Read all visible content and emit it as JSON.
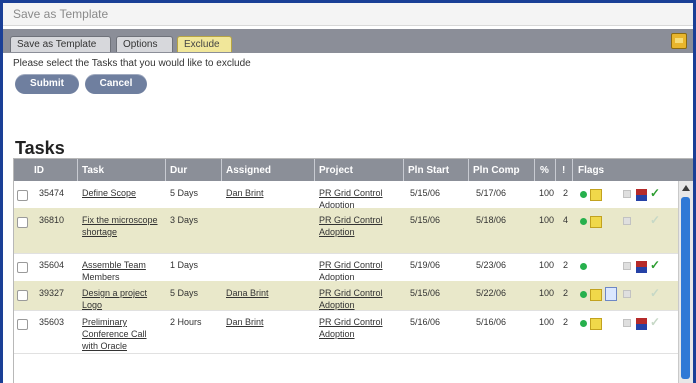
{
  "window": {
    "title": "Save as Template"
  },
  "tabs": [
    "Save as Template",
    "Options",
    "Exclude"
  ],
  "instructions": "Please select the Tasks that you would like to exclude",
  "buttons": {
    "submit": "Submit",
    "cancel": "Cancel"
  },
  "section_title": "Tasks",
  "table": {
    "columns": [
      "ID",
      "Task",
      "Dur",
      "Assigned",
      "Project",
      "Pln Start",
      "Pln Comp",
      "%",
      "!",
      "Flags"
    ],
    "rows": [
      {
        "id": "35474",
        "task": "Define Scope",
        "dur": "5 Days",
        "assigned": "Dan Brint",
        "project": "PR Grid Control Adoption",
        "start": "5/15/06",
        "comp": "5/17/06",
        "pct": "100",
        "pri": "2"
      },
      {
        "id": "36810",
        "task": "Fix the microscope shortage",
        "dur": "3 Days",
        "assigned": "",
        "project": "PR Grid Control Adoption",
        "start": "5/15/06",
        "comp": "5/18/06",
        "pct": "100",
        "pri": "4"
      },
      {
        "id": "35604",
        "task": "Assemble Team Members",
        "dur": "1 Days",
        "assigned": "",
        "project": "PR Grid Control Adoption",
        "start": "5/19/06",
        "comp": "5/23/06",
        "pct": "100",
        "pri": "2"
      },
      {
        "id": "39327",
        "task": "Design a project Logo",
        "dur": "5 Days",
        "assigned": "Dana Brint",
        "project": "PR Grid Control Adoption",
        "start": "5/15/06",
        "comp": "5/22/06",
        "pct": "100",
        "pri": "2"
      },
      {
        "id": "35603",
        "task": "Preliminary Conference Call with Oracle",
        "dur": "2 Hours",
        "assigned": "Dan Brint",
        "project": "PR Grid Control Adoption",
        "start": "5/16/06",
        "comp": "5/16/06",
        "pct": "100",
        "pri": "2"
      }
    ]
  },
  "colors": {
    "frame": "#1a3f96",
    "tabbar": "#8b8e98",
    "active_tab": "#f1e79a",
    "header": "#8b8f98",
    "alt_row": "#e9e8ca"
  }
}
